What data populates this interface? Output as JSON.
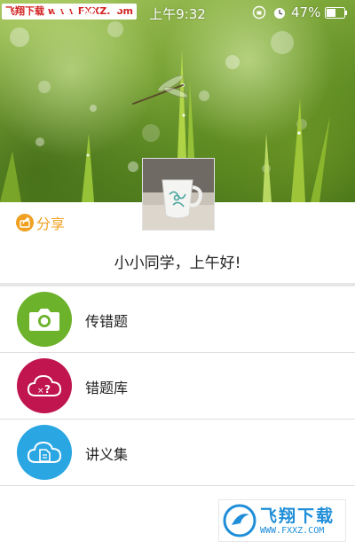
{
  "status_bar": {
    "carrier_badge": "飞翔下载 www.FXXZ.com",
    "time": "上午9:32",
    "battery_percent": "47%",
    "icons": [
      "signal-icon",
      "wifi-icon",
      "rotation-lock-icon",
      "alarm-icon",
      "battery-icon"
    ]
  },
  "header": {
    "banner_image": "green-grass-dragonfly-photo",
    "avatar_image": "teacup-photo"
  },
  "share": {
    "label": "分享",
    "icon": "share-icon"
  },
  "greeting": "小小同学，上午好!",
  "menu": {
    "items": [
      {
        "label": "传错题",
        "icon": "camera-icon",
        "color": "#6cb22b"
      },
      {
        "label": "错题库",
        "icon": "question-cloud-icon",
        "color": "#c0154f"
      },
      {
        "label": "讲义集",
        "icon": "document-cloud-icon",
        "color": "#2aa6e3"
      }
    ]
  },
  "watermark": {
    "title": "飞翔下载",
    "url": "WWW.FXXZ.COM"
  },
  "colors": {
    "accent_orange": "#f0a122",
    "divider": "#e6e6e6"
  }
}
